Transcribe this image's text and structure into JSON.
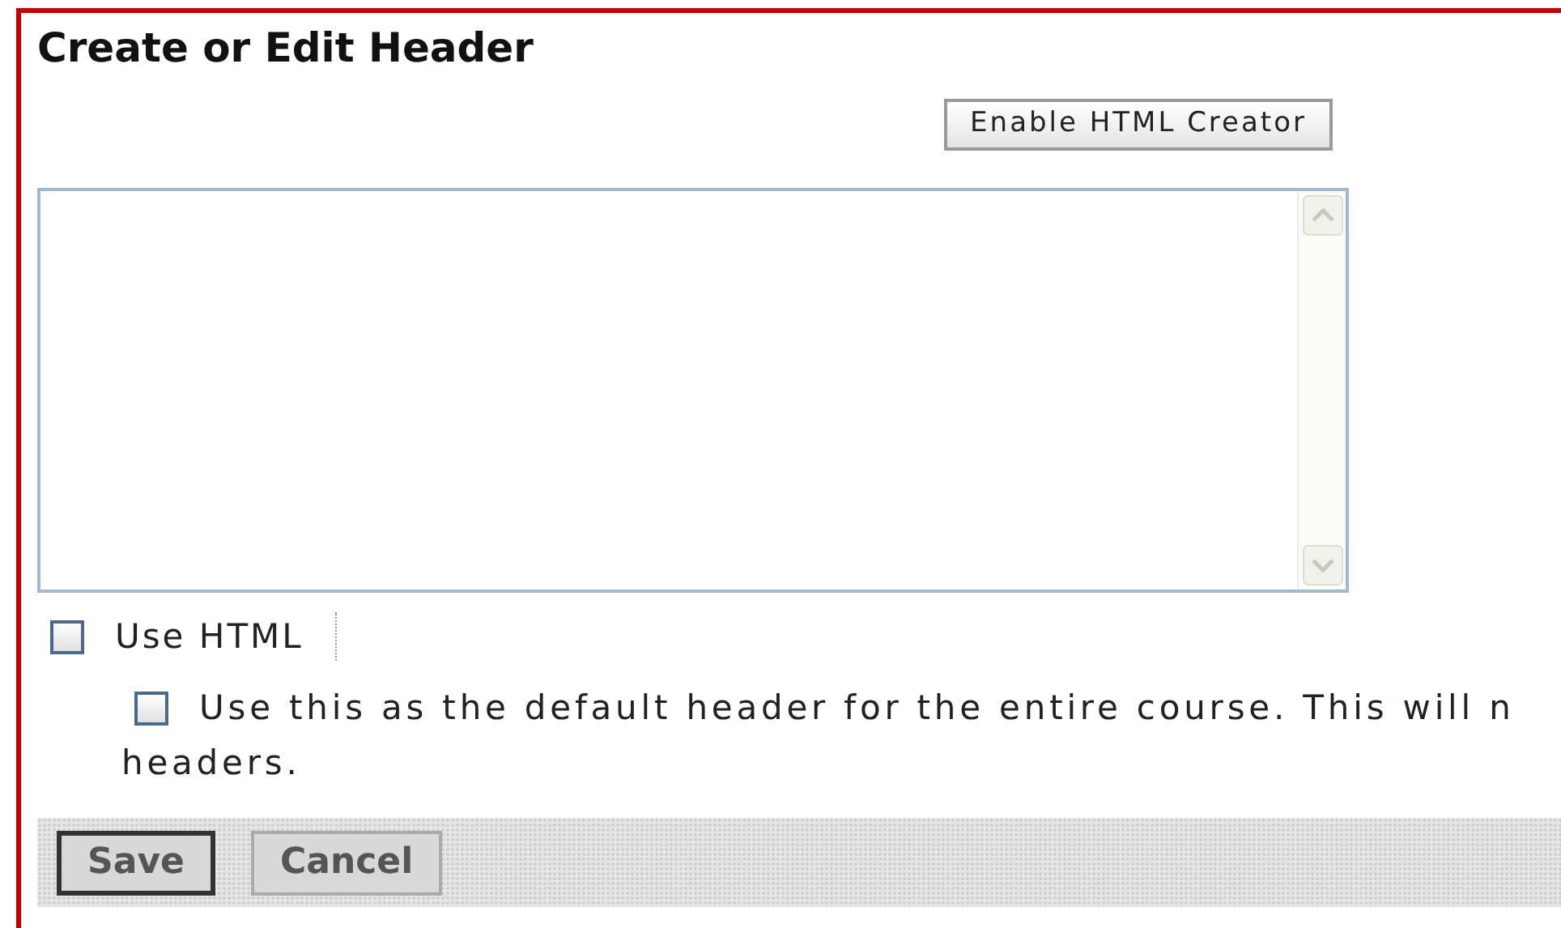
{
  "title": "Create or Edit Header",
  "enable_button": "Enable HTML Creator",
  "use_html": {
    "label": "Use HTML",
    "checked": false
  },
  "default_header": {
    "label_line_1": "Use this as the default header for the entire course. This will n",
    "label_line_2": "headers.",
    "checked": false
  },
  "buttons": [
    {
      "label": "Save",
      "focused": true
    },
    {
      "label": "Cancel",
      "focused": false
    }
  ]
}
